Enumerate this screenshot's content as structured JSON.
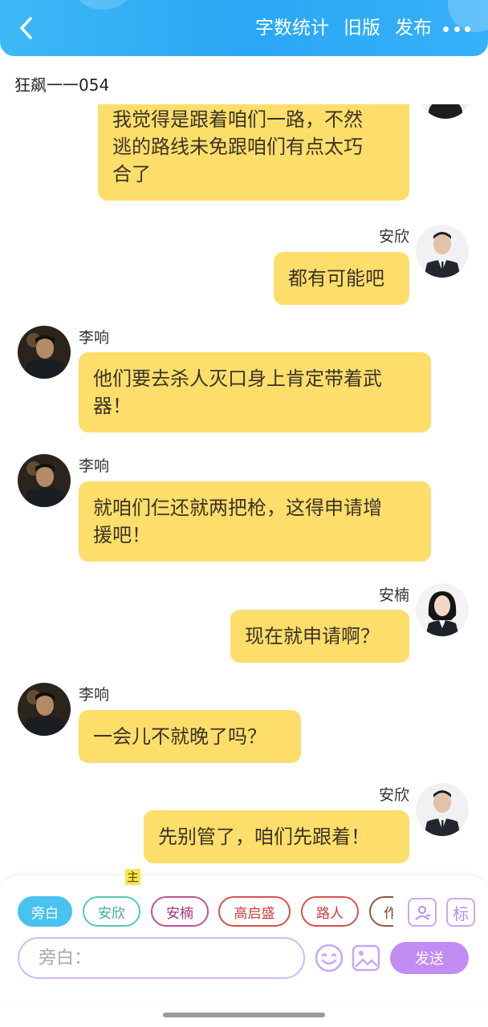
{
  "header": {
    "actions": [
      "字数统计",
      "旧版",
      "发布"
    ]
  },
  "chat": {
    "title": "狂飙一一054"
  },
  "messages": [
    {
      "speaker": "",
      "side": "right",
      "text_lines": [
        "我觉得是跟着咱们一路，不然",
        "逃的路线未免跟咱们有点太巧",
        "合了"
      ]
    },
    {
      "speaker": "安欣",
      "side": "right",
      "text_lines": [
        "都有可能吧"
      ]
    },
    {
      "speaker": "李响",
      "side": "left",
      "text_lines": [
        "他们要去杀人灭口身上肯定带着武",
        "器！"
      ]
    },
    {
      "speaker": "李响",
      "side": "left",
      "text_lines": [
        "就咱们仨还就两把枪，这得申请增",
        "援吧！"
      ]
    },
    {
      "speaker": "安楠",
      "side": "right",
      "text_lines": [
        "现在就申请啊？"
      ]
    },
    {
      "speaker": "李响",
      "side": "left",
      "text_lines": [
        "一会儿不就晚了吗？"
      ]
    },
    {
      "speaker": "安欣",
      "side": "right",
      "text_lines": [
        "先别管了，咱们先跟着！"
      ]
    }
  ],
  "composer": {
    "chips": [
      "旁白",
      "安欣",
      "安楠",
      "高启盛",
      "路人",
      "作"
    ],
    "main_tag": "主",
    "label_icon_text": "标",
    "input_placeholder": "旁白：",
    "send_label": "发送"
  },
  "colors": {
    "header": "#2aa7f5",
    "bubble": "#fede6a",
    "accent_purple": "#c28cf3",
    "chip_active": "#48c2ee"
  }
}
